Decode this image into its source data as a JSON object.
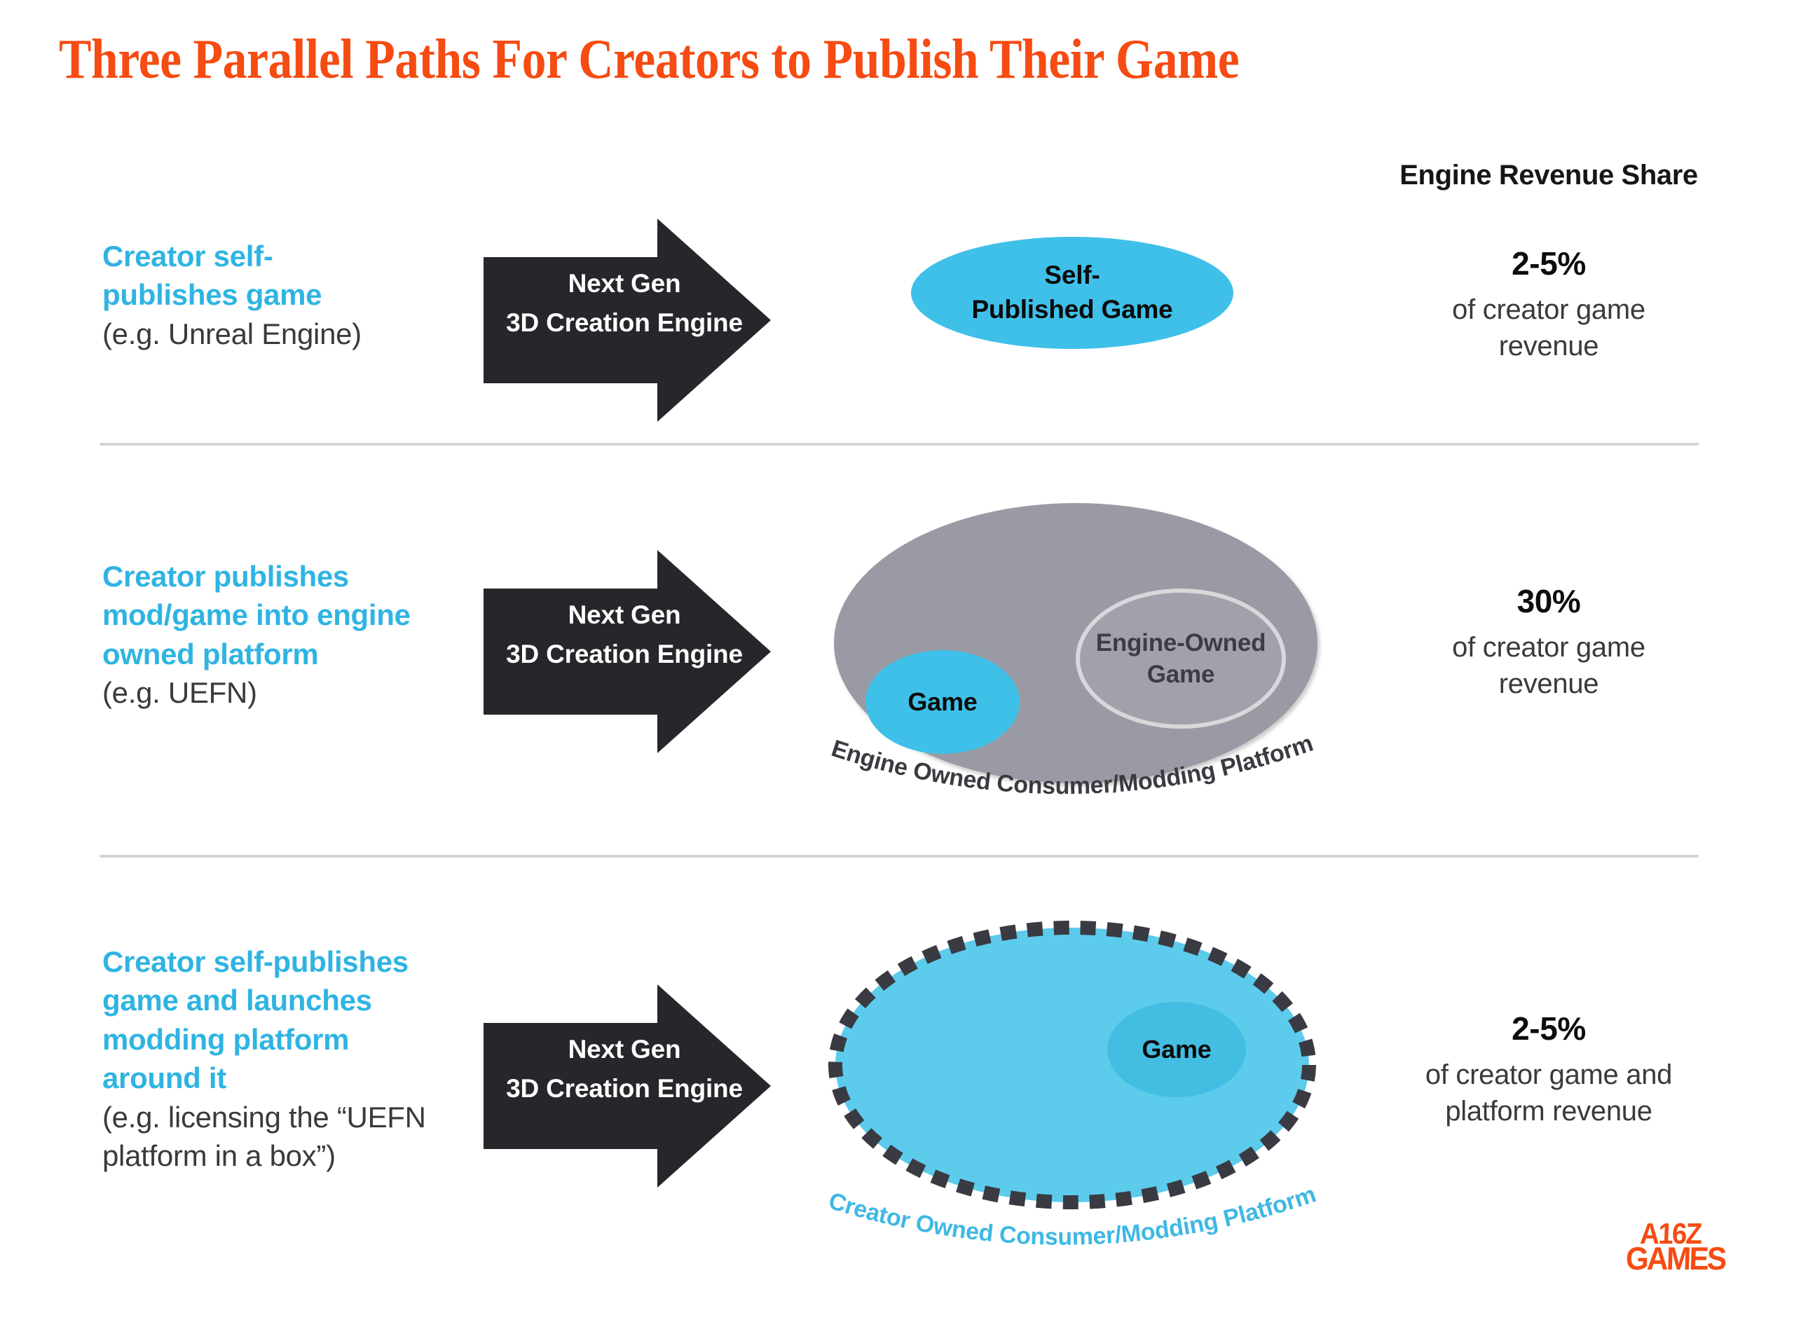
{
  "title": "Three Parallel Paths For Creators to Publish Their Game",
  "revenue_header": "Engine Revenue Share",
  "colors": {
    "title_orange": "#F64B12",
    "accent_cyan": "#2FB4E2",
    "ellipse_blue": "#3FC0E8",
    "platform_gray": "#9A9AA5",
    "arrow_dark": "#26262B",
    "body_gray": "#3A3A3C",
    "divider_gray": "#D4D4D6"
  },
  "arrow_label": {
    "line1": "Next Gen",
    "line2": "3D Creation Engine"
  },
  "rows": [
    {
      "id": "row-self-publish",
      "desc_highlight_lines": [
        "Creator self-",
        "publishes game"
      ],
      "desc_sub": "(e.g. Unreal Engine)",
      "arrow": {
        "line1": "Next Gen",
        "line2": "3D Creation Engine"
      },
      "diagram": {
        "type": "single-ellipse",
        "ellipse_label_lines": [
          "Self-",
          "Published Game"
        ]
      },
      "revenue": {
        "percent": "2-5%",
        "note_lines": [
          "of creator game",
          "revenue"
        ]
      }
    },
    {
      "id": "row-engine-platform",
      "desc_highlight_lines": [
        "Creator publishes",
        "mod/game into engine",
        "owned platform"
      ],
      "desc_sub": "(e.g. UEFN)",
      "arrow": {
        "line1": "Next Gen",
        "line2": "3D Creation Engine"
      },
      "diagram": {
        "type": "gray-platform-ellipse",
        "platform_caption": "Engine Owned Consumer/Modding Platform",
        "inner_game_label": "Game",
        "inner_outline_label_lines": [
          "Engine-Owned",
          "Game"
        ]
      },
      "revenue": {
        "percent": "30%",
        "note_lines": [
          "of creator game",
          "revenue"
        ]
      }
    },
    {
      "id": "row-creator-platform",
      "desc_highlight_lines": [
        "Creator self-publishes",
        "game and launches",
        "modding platform",
        "around it"
      ],
      "desc_sub_lines": [
        "(e.g. licensing the “UEFN",
        "platform in a box”)"
      ],
      "arrow": {
        "line1": "Next Gen",
        "line2": "3D Creation Engine"
      },
      "diagram": {
        "type": "dashed-cyan-platform-ellipse",
        "platform_caption": "Creator Owned Consumer/Modding Platform",
        "inner_game_label": "Game"
      },
      "revenue": {
        "percent": "2-5%",
        "note_lines": [
          "of creator game and",
          "platform revenue"
        ]
      }
    }
  ],
  "logo": {
    "line1": "A16Z",
    "line2": "GAMES"
  }
}
